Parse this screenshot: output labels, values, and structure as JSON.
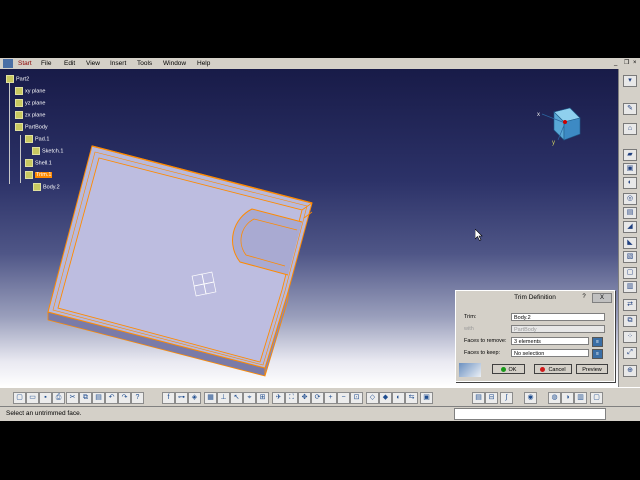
{
  "menubar": {
    "items": [
      "Start",
      "File",
      "Edit",
      "View",
      "Insert",
      "Tools",
      "Window",
      "Help"
    ]
  },
  "tree": {
    "root": "Part2",
    "nodes": [
      "xy plane",
      "yz plane",
      "zx plane",
      "PartBody",
      "Pad.1",
      "Sketch.1",
      "Shell.1",
      "Trim.1",
      "Body.2"
    ]
  },
  "dialog": {
    "title": "Trim Definition",
    "help": "?",
    "close": "X",
    "trim_label": "Trim:",
    "trim_value": "Body.2",
    "with_label": "with",
    "with_value": "PartBody",
    "faces_remove_label": "Faces to remove:",
    "faces_remove_value": "3 elements",
    "faces_keep_label": "Faces to keep:",
    "faces_keep_value": "No selection",
    "ok_label": "OK",
    "cancel_label": "Cancel",
    "preview_label": "Preview"
  },
  "status": {
    "text": "Select an untrimmed face."
  },
  "compass": {
    "x_label": "x",
    "y_label": "y"
  },
  "colors": {
    "highlight": "#ff8a00",
    "part_face": "#b8b9dc",
    "viewport_top": "#181b48",
    "viewport_bottom": "#ffffff"
  }
}
